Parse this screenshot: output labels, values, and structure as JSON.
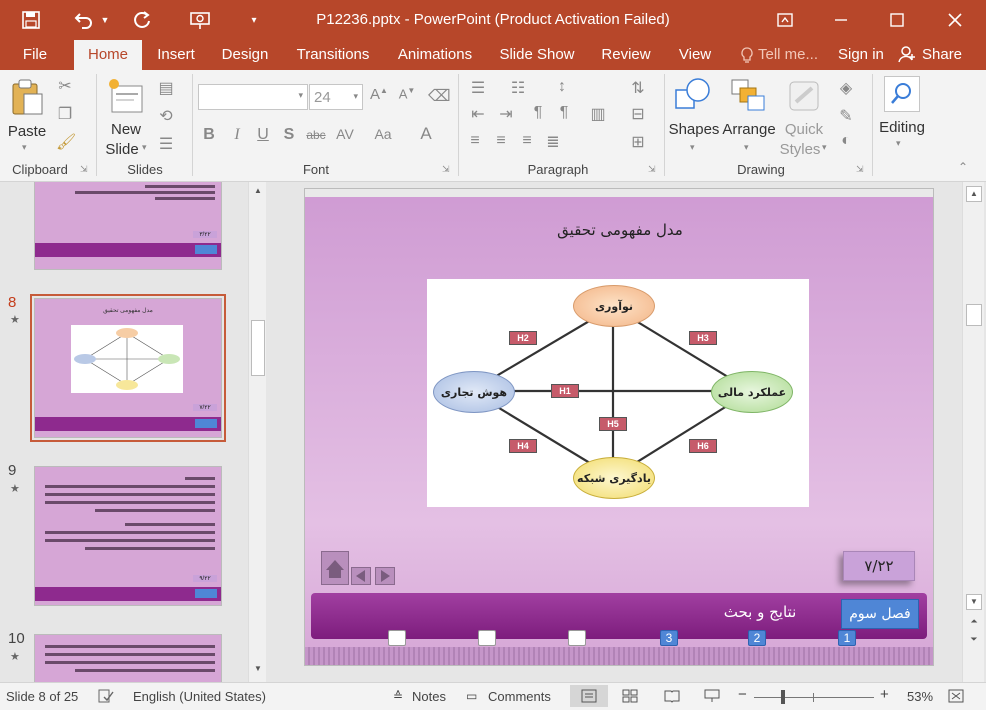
{
  "window": {
    "title": "P12236.pptx - PowerPoint (Product Activation Failed)"
  },
  "tabs": [
    "File",
    "Home",
    "Insert",
    "Design",
    "Transitions",
    "Animations",
    "Slide Show",
    "Review",
    "View"
  ],
  "tell_me": "Tell me...",
  "sign_in": "Sign in",
  "share": "Share",
  "ribbon": {
    "clipboard": {
      "paste": "Paste",
      "label": "Clipboard"
    },
    "slides": {
      "new_slide_line1": "New",
      "new_slide_line2": "Slide",
      "label": "Slides"
    },
    "font": {
      "size": "24",
      "label": "Font",
      "bold": "B",
      "italic": "I",
      "underline": "U",
      "shadow": "S",
      "strike": "abc",
      "spacing": "AV",
      "case": "Aa",
      "color": "A"
    },
    "paragraph": {
      "label": "Paragraph"
    },
    "drawing": {
      "shapes": "Shapes",
      "arrange": "Arrange",
      "quick_line1": "Quick",
      "quick_line2": "Styles",
      "label": "Drawing"
    },
    "editing": {
      "label": "Editing"
    }
  },
  "thumbnails": [
    {
      "num": "",
      "page": "۳/۲۲"
    },
    {
      "num": "8",
      "title": "مدل مفهومی تحقیق",
      "page": "۷/۲۲"
    },
    {
      "num": "9",
      "page": "۹/۲۲"
    },
    {
      "num": "10",
      "page": ""
    }
  ],
  "slide": {
    "title": "مدل مفهومی تحقیق",
    "diagram": {
      "nodes": {
        "top": "نوآوری",
        "left": "هوش تجاری",
        "right": "عملکرد مالی",
        "bottom": "یادگیری شبکه"
      },
      "hypotheses": [
        "H1",
        "H2",
        "H3",
        "H4",
        "H5",
        "H6"
      ]
    },
    "page_number": "۷/۲۲",
    "footer_title": "نتایج و بحث",
    "chapter_button": "فصل سوم",
    "nav_numbers": [
      "1",
      "2",
      "3"
    ]
  },
  "status": {
    "slide_info": "Slide 8 of 25",
    "language": "English (United States)",
    "notes": "Notes",
    "comments": "Comments",
    "zoom": "53%"
  },
  "colors": {
    "accent": "#b7472a",
    "slide_bg": "#d6a6d6",
    "footer": "#8e2a8e",
    "chapter_btn": "#4f86d6"
  }
}
